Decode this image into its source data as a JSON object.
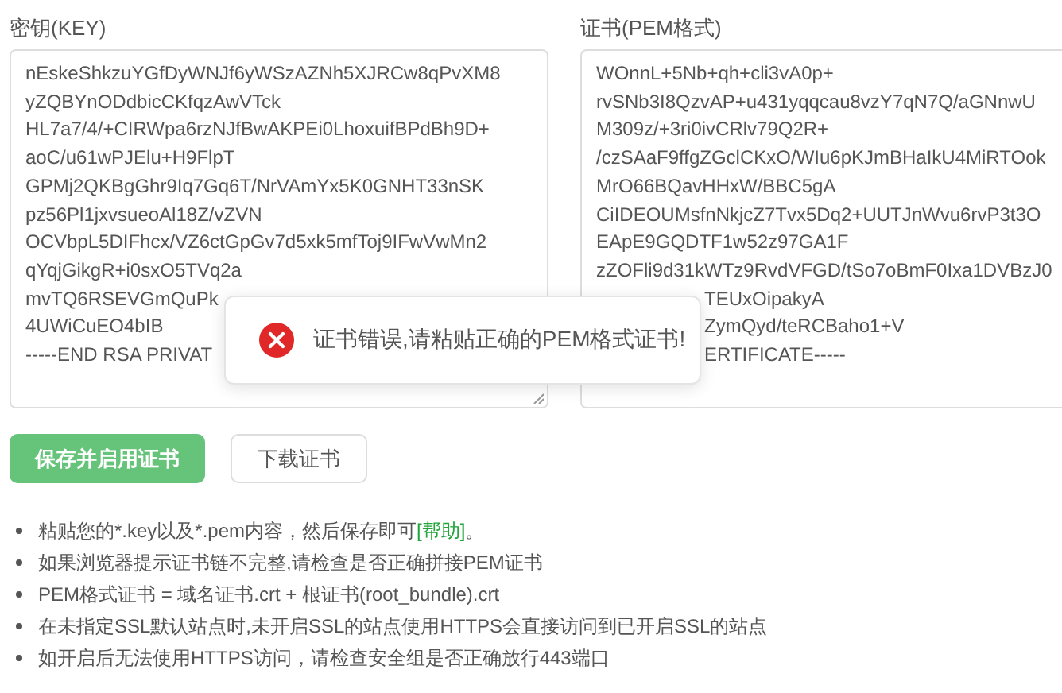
{
  "key_field": {
    "label": "密钥(KEY)",
    "lines": [
      "nEskeShkzuYGfDyWNJf6yWSzAZNh5XJRCw8qPvXM8",
      "yZQBYnODdbicCKfqzAwVTck",
      "HL7a7/4/+CIRWpa6rzNJfBwAKPEi0LhoxuifBPdBh9D+",
      "aoC/u61wPJElu+H9FlpT",
      "GPMj2QKBgGhr9Iq7Gq6T/NrVAmYx5K0GNHT33nSK",
      "pz56Pl1jxvsueoAl18Z/vZVN",
      "OCVbpL5DIFhcx/VZ6ctGpGv7d5xk5mfToj9IFwVwMn2",
      "qYqjGikgR+i0sxO5TVq2a",
      "mvTQ6RSEVGmQuPk",
      "4UWiCuEO4bIB",
      "-----END RSA PRIVAT"
    ]
  },
  "cert_field": {
    "label": "证书(PEM格式)",
    "lines": [
      "WOnnL+5Nb+qh+cli3vA0p+",
      "rvSNb3I8QzvAP+u431yqqcau8vzY7qN7Q/aGNnwU",
      "M309z/+3ri0ivCRlv79Q2R+",
      "/czSAaF9ffgZGclCKxO/WIu6pKJmBHaIkU4MiRTOok",
      "MrO66BQavHHxW/BBC5gA",
      "CiIDEOUMsfnNkjcZ7Tvx5Dq2+UUTJnWvu6rvP3t3O",
      "EApE9GQDTF1w52z97GA1F",
      "zZOFli9d31kWTz9RvdVFGD/tSo7oBmF0Ixa1DVBzJ0"
    ],
    "tail_lines": [
      "TEUxOipakyA",
      "ZymQyd/teRCBaho1+V",
      "ERTIFICATE-----"
    ]
  },
  "buttons": [
    {
      "label": "保存并启用证书",
      "kind": "primary"
    },
    {
      "label": "下载证书",
      "kind": "default"
    }
  ],
  "tips": [
    {
      "text": "粘贴您的*.key以及*.pem内容，然后保存即可",
      "link": "[帮助]",
      "after": "。"
    },
    {
      "text": "如果浏览器提示证书链不完整,请检查是否正确拼接PEM证书"
    },
    {
      "text": "PEM格式证书 = 域名证书.crt + 根证书(root_bundle).crt"
    },
    {
      "text": "在未指定SSL默认站点时,未开启SSL的站点使用HTTPS会直接访问到已开启SSL的站点"
    },
    {
      "text": "如开启后无法使用HTTPS访问，请检查安全组是否正确放行443端口"
    }
  ],
  "toast": {
    "kind": "error",
    "message": "证书错误,请粘贴正确的PEM格式证书!"
  }
}
